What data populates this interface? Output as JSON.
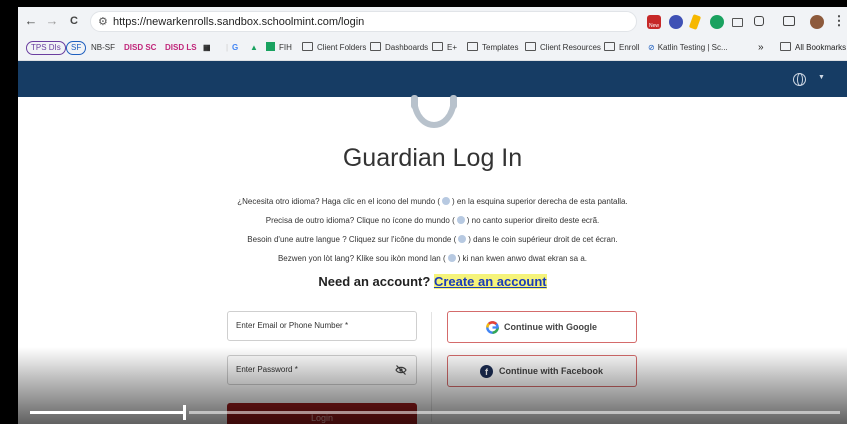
{
  "browser": {
    "url": "https://newarkenrolls.sandbox.schoolmint.com/login",
    "nav": {
      "back": "←",
      "forward": "→",
      "reload": "C"
    },
    "extension_badge": "New",
    "bookmarks": [
      {
        "label": "TPS DIs",
        "style": "pill",
        "color": "#6b3fa0"
      },
      {
        "label": "SF",
        "style": "pill",
        "color": "#1f5fbf"
      },
      {
        "label": "NB-SF",
        "style": "text",
        "color": "#333333"
      },
      {
        "label": "DISD SC",
        "style": "text",
        "color": "#c0267a"
      },
      {
        "label": "DISD LS",
        "style": "text",
        "color": "#c0267a"
      },
      {
        "label": "G",
        "style": "icon-g",
        "color": "#4285f4"
      },
      {
        "label": "FIH",
        "style": "sheet",
        "color": "#333333"
      },
      {
        "label": "Client Folders",
        "style": "folder",
        "color": "#333333"
      },
      {
        "label": "Dashboards",
        "style": "folder",
        "color": "#333333"
      },
      {
        "label": "E+",
        "style": "folder",
        "color": "#333333"
      },
      {
        "label": "Templates",
        "style": "folder",
        "color": "#333333"
      },
      {
        "label": "Client Resources",
        "style": "folder",
        "color": "#333333"
      },
      {
        "label": "Enroll",
        "style": "folder",
        "color": "#333333"
      },
      {
        "label": "Katlin Testing | Sc...",
        "style": "link",
        "color": "#333333"
      }
    ],
    "more": "»",
    "all_bookmarks": "All Bookmarks"
  },
  "page": {
    "title": "Guardian Log In",
    "language_notes": [
      {
        "before": "¿Necesita otro idioma? Haga clic en el icono del mundo (",
        "after": ") en la esquina superior derecha de esta pantalla."
      },
      {
        "before": "Precisa de outro idioma? Clique no ícone do mundo (",
        "after": ") no canto superior direito deste ecrã."
      },
      {
        "before": "Besoin d'une autre langue ? Cliquez sur l'icône du monde (",
        "after": ") dans le coin supérieur droit de cet écran."
      },
      {
        "before": "Bezwen yon lòt lang? Klike sou ikòn mond lan (",
        "after": ") ki nan kwen anwo dwat ekran sa a."
      }
    ],
    "need_account": "Need an account?",
    "create_account": "Create an account",
    "email_label": "Enter Email or Phone Number *",
    "password_label": "Enter Password *",
    "login_button": "Login",
    "google_button": "Continue with Google",
    "facebook_button": "Continue with Facebook",
    "facebook_glyph": "f"
  },
  "video": {
    "progress": 0.19
  },
  "colors": {
    "header": "#163c64",
    "login_button": "#9c1c1c",
    "create_link": "#1a3cb8",
    "highlight": "#f5f37a",
    "social_border": "#d46b6b"
  }
}
